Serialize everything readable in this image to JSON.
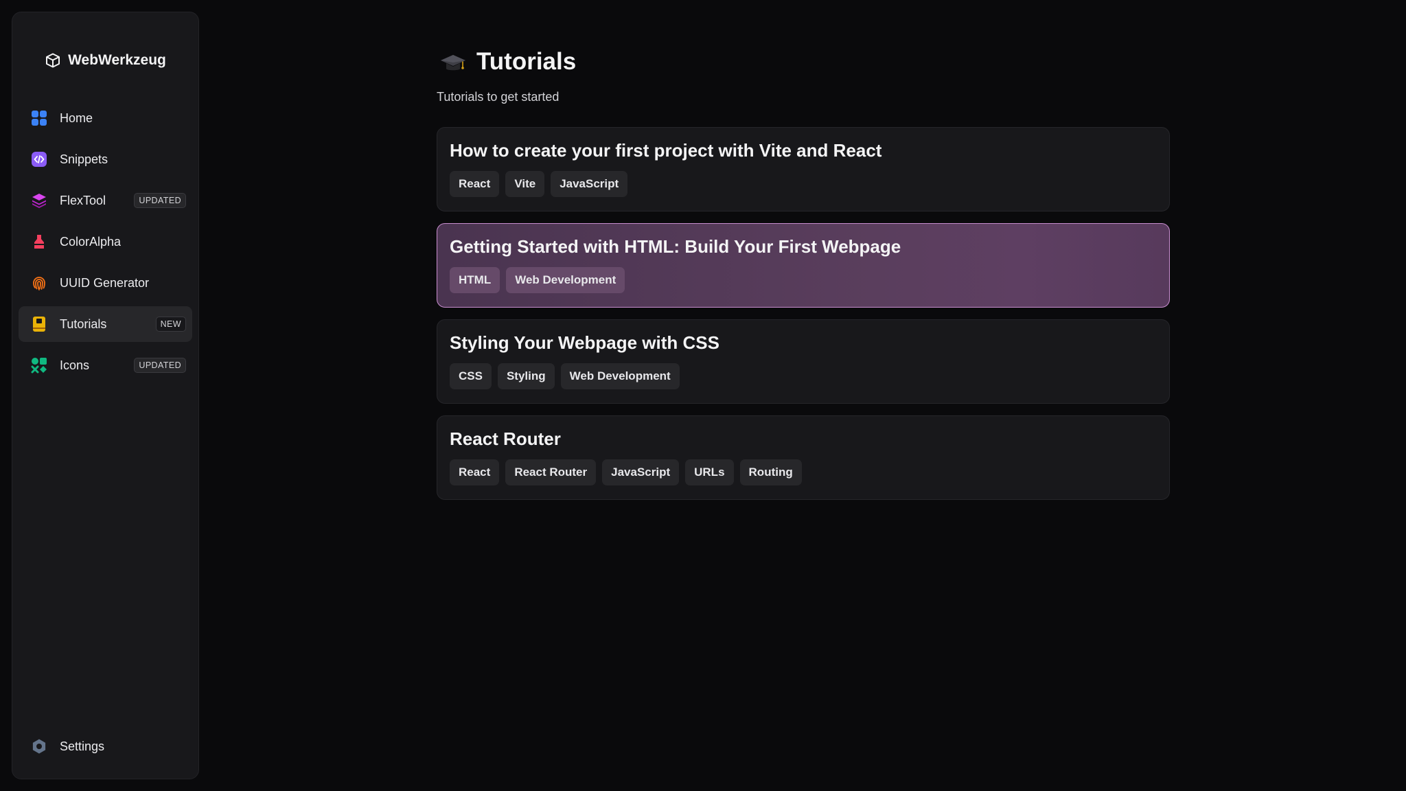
{
  "sidebar": {
    "brand": "WebWerkzeug",
    "items": [
      {
        "label": "Home",
        "icon": "grid-icon",
        "badge": ""
      },
      {
        "label": "Snippets",
        "icon": "code-icon",
        "badge": ""
      },
      {
        "label": "FlexTool",
        "icon": "layers-icon",
        "badge": "UPDATED"
      },
      {
        "label": "ColorAlpha",
        "icon": "paint-bucket-icon",
        "badge": ""
      },
      {
        "label": "UUID Generator",
        "icon": "fingerprint-icon",
        "badge": ""
      },
      {
        "label": "Tutorials",
        "icon": "book-icon",
        "badge": "NEW"
      },
      {
        "label": "Icons",
        "icon": "shapes-icon",
        "badge": "UPDATED"
      }
    ],
    "settings": {
      "label": "Settings",
      "icon": "gear-icon"
    }
  },
  "page": {
    "title": "Tutorials",
    "subtitle": "Tutorials to get started"
  },
  "tutorials": [
    {
      "title": "How to create your first project with Vite and React",
      "tags": [
        "React",
        "Vite",
        "JavaScript"
      ]
    },
    {
      "title": "Getting Started with HTML: Build Your First Webpage",
      "tags": [
        "HTML",
        "Web Development"
      ]
    },
    {
      "title": "Styling Your Webpage with CSS",
      "tags": [
        "CSS",
        "Styling",
        "Web Development"
      ]
    },
    {
      "title": "React Router",
      "tags": [
        "React",
        "React Router",
        "JavaScript",
        "URLs",
        "Routing"
      ]
    }
  ],
  "colors": {
    "background": "#0a0a0c",
    "sidebar": "#18181b",
    "hover_card_border": "#c98ed0",
    "hover_card_bg": "#5a3e5d"
  }
}
